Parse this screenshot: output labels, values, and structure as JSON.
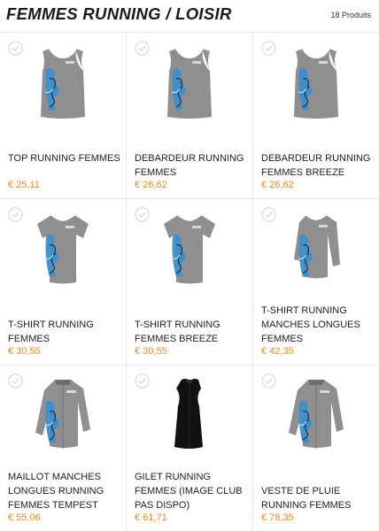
{
  "header": {
    "title": "FEMMES RUNNING / LOISIR",
    "count": "18 Produits"
  },
  "colors": {
    "price": "#e58a1f",
    "garment_grey": "#8f8f92",
    "pattern_blue": "#3d8fc9",
    "vest_black": "#111111"
  },
  "products": [
    {
      "name": "TOP RUNNING FEMMES",
      "price": "€ 25,11",
      "icon": "tank-top-icon"
    },
    {
      "name": "DEBARDEUR RUNNING FEMMES",
      "price": "€ 26,62",
      "icon": "tank-top-icon"
    },
    {
      "name": "DEBARDEUR RUNNING FEMMES BREEZE",
      "price": "€ 26,62",
      "icon": "tank-top-icon"
    },
    {
      "name": "T-SHIRT RUNNING FEMMES",
      "price": "€ 30,55",
      "icon": "tshirt-icon"
    },
    {
      "name": "T-SHIRT RUNNING FEMMES BREEZE",
      "price": "€ 30,55",
      "icon": "tshirt-icon"
    },
    {
      "name": "T-SHIRT RUNNING MANCHES LONGUES FEMMES",
      "price": "€ 42,35",
      "icon": "long-sleeve-shirt-icon"
    },
    {
      "name": "MAILLOT MANCHES LONGUES RUNNING FEMMES TEMPEST",
      "price": "€ 55,06",
      "icon": "jacket-icon"
    },
    {
      "name": "GILET RUNNING FEMMES (IMAGE CLUB PAS DISPO)",
      "price": "€ 61,71",
      "icon": "gilet-icon"
    },
    {
      "name": "VESTE DE PLUIE RUNNING FEMMES",
      "price": "€ 78,35",
      "icon": "jacket-icon"
    }
  ]
}
